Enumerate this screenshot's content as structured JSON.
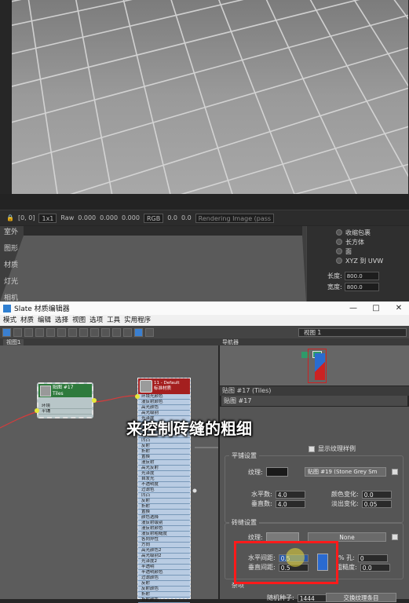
{
  "toolbar": {
    "coords": "[0, 0]",
    "scale": "1x1",
    "mode": "Raw",
    "v1": "0.000",
    "v2": "0.000",
    "v3": "0.000",
    "channel": "RGB",
    "v4": "0.0",
    "v5": "0.0",
    "status": "Rendering Image (pass"
  },
  "viewport_labels": [
    "室外",
    "图形",
    "材质",
    "灯光",
    "相机"
  ],
  "right_panel": {
    "options": [
      "收缩包裹",
      "长方体",
      "面",
      "XYZ 到 UVW"
    ],
    "length_label": "长度:",
    "length_value": "800.0",
    "width_label": "宽度:",
    "width_value": "800.0"
  },
  "slate": {
    "title": "Slate 材质编辑器",
    "menu": [
      "模式",
      "材质",
      "编辑",
      "选择",
      "视图",
      "选项",
      "工具",
      "实用程序"
    ],
    "view_select": "视图 1",
    "tab": "视图1",
    "navigator_label": "导航器",
    "param_header": "贴图 #17 (Tiles)",
    "param_name": "贴图 #17"
  },
  "tiles_node": {
    "name": "贴图 #17",
    "type": "Tiles",
    "slots": [
      "环境",
      "平铺"
    ]
  },
  "std_node": {
    "title": "11 - Default",
    "subtitle": "标准材质",
    "slots": [
      "环境光颜色",
      "漫反射颜色",
      "高光颜色",
      "高光级别",
      "光泽度",
      "自发光",
      "不透明度",
      "过滤色",
      "凹凸",
      "反射",
      "折射",
      "置换",
      "漫反射",
      "高光反射",
      "光泽度",
      "自发光",
      "不透明度",
      "过滤色",
      "凹凸",
      "反射",
      "折射",
      "置换",
      "颜色选择",
      "漫反射级别",
      "漫反射颜色",
      "漫反射粗糙度",
      "各向异性",
      "方向",
      "高光颜色2",
      "高光级别2",
      "光泽度2",
      "半透明",
      "半透明颜色",
      "过滤颜色",
      "反射",
      "反射颜色",
      "折射",
      "折射颜色"
    ]
  },
  "params": {
    "show_texture": "显示纹理样例",
    "advanced_title": "平铺设置",
    "texture_label": "纹理:",
    "texture_map": "贴图 #19 (Stone Grey Sm",
    "h_count_label": "水平数:",
    "h_count": "4.0",
    "v_count_label": "垂直数:",
    "v_count": "4.0",
    "color_var_label": "颜色变化:",
    "color_var": "0.0",
    "fade_var_label": "淡出变化:",
    "fade_var": "0.05",
    "grout_title": "砖缝设置",
    "grout_texture_label": "纹理:",
    "grout_map": "None",
    "h_gap_label": "水平间距:",
    "h_gap": "0.5",
    "v_gap_label": "垂直间距:",
    "v_gap": "0.5",
    "holes_label": "% 孔:",
    "holes": "0",
    "rough_label": "粗糙度:",
    "rough": "0.0",
    "misc_title": "杂项",
    "seed_label": "随机种子:",
    "seed": "1444",
    "swap_button": "交换纹理条目"
  },
  "caption": "来控制砖缝的粗细"
}
